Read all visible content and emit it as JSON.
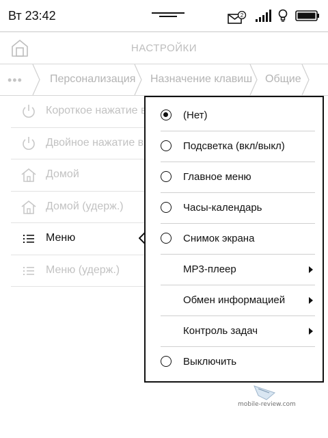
{
  "status_bar": {
    "time": "Вт 23:42",
    "mail_badge": "2",
    "icons": [
      "mail-icon",
      "signal-icon",
      "light-bulb-icon",
      "battery-icon"
    ]
  },
  "header": {
    "title": "НАСТРОЙКИ",
    "home_icon": "home-icon"
  },
  "breadcrumbs": {
    "overflow": "•••",
    "items": [
      "Персонализация",
      "Назначение клавиш",
      "Общие"
    ]
  },
  "settings_list": {
    "items": [
      {
        "label": "Короткое нажатие в",
        "icon": "power-icon"
      },
      {
        "label": "Двойное нажатие вк",
        "icon": "power-icon"
      },
      {
        "label": "Домой",
        "icon": "house-icon"
      },
      {
        "label": "Домой (удерж.)",
        "icon": "house-icon"
      },
      {
        "label": "Меню",
        "icon": "menu-list-icon"
      },
      {
        "label": "Меню (удерж.)",
        "icon": "menu-list-icon"
      }
    ]
  },
  "popup_menu": {
    "items": [
      {
        "label": "(Нет)",
        "type": "radio",
        "selected": true
      },
      {
        "label": "Подсветка (вкл/выкл)",
        "type": "radio",
        "selected": false
      },
      {
        "label": "Главное меню",
        "type": "radio",
        "selected": false
      },
      {
        "label": "Часы-календарь",
        "type": "radio",
        "selected": false
      },
      {
        "label": "Снимок экрана",
        "type": "radio",
        "selected": false
      },
      {
        "label": "MP3-плеер",
        "type": "submenu"
      },
      {
        "label": "Обмен информацией",
        "type": "submenu"
      },
      {
        "label": "Контроль задач",
        "type": "submenu"
      },
      {
        "label": "Выключить",
        "type": "radio",
        "selected": false
      }
    ]
  },
  "watermark": {
    "text": "mobile-review.com"
  },
  "colors": {
    "text": "#111111",
    "muted_text": "#c2c2c2",
    "divider": "#d6d6d6",
    "popup_border": "#111111"
  }
}
